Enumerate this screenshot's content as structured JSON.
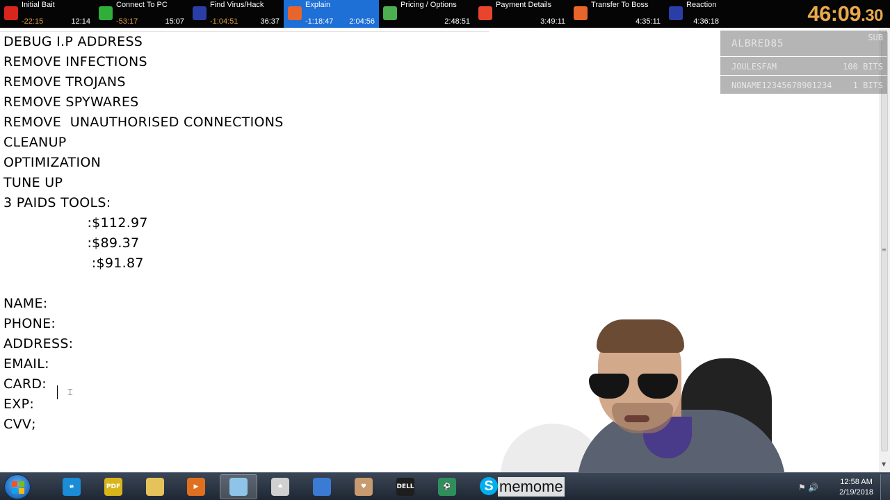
{
  "splits": [
    {
      "name": "Initial Bait",
      "delta": "-22:15",
      "time": "12:14",
      "icon": "flag-icon",
      "color": "#d8261c",
      "delta_color": "#e0a040"
    },
    {
      "name": "Connect To PC",
      "delta": "-53:17",
      "time": "15:07",
      "icon": "shield-icon",
      "color": "#2fae3a",
      "delta_color": "#e0a040"
    },
    {
      "name": "Find Virus/Hack",
      "delta": "-1:04:51",
      "time": "36:37",
      "icon": "virus-icon",
      "color": "#2a3ea8",
      "delta_color": "#e0a040"
    },
    {
      "name": "Explain",
      "delta": "-1:18:47",
      "time": "2:04:56",
      "icon": "envelope-icon",
      "color": "#e8652c",
      "delta_color": "#ffffff"
    },
    {
      "name": "Pricing / Options",
      "delta": "",
      "time": "2:48:51",
      "icon": "money-icon",
      "color": "#4caf50",
      "delta_color": "#e0a040"
    },
    {
      "name": "Payment Details",
      "delta": "",
      "time": "3:49:11",
      "icon": "fire-icon",
      "color": "#e8452c",
      "delta_color": "#e0a040"
    },
    {
      "name": "Transfer To Boss",
      "delta": "",
      "time": "4:35:11",
      "icon": "envelope-icon",
      "color": "#e8652c",
      "delta_color": "#e0a040"
    },
    {
      "name": "Reaction",
      "delta": "",
      "time": "4:36:18",
      "icon": "face-icon",
      "color": "#2a3ea8",
      "delta_color": "#e0a040"
    }
  ],
  "timer": {
    "main": "46:09",
    "fraction": ".30",
    "color": "#e8a94c"
  },
  "document": {
    "lines": [
      "DEBUG I.P ADDRESS",
      "REMOVE INFECTIONS",
      "REMOVE TROJANS",
      "REMOVE SPYWARES",
      "REMOVE  UNAUTHORISED CONNECTIONS",
      "CLEANUP",
      "OPTIMIZATION",
      "TUNE UP",
      "3 PAIDS TOOLS:",
      "                   :$112.97",
      "                   :$89.37",
      "                    :$91.87",
      "",
      "NAME:",
      "PHONE:",
      "ADDRESS:",
      "EMAIL:",
      "CARD:",
      "EXP:",
      "CVV;"
    ]
  },
  "alerts": {
    "top": {
      "name": "ALBRED85",
      "value": "SUB"
    },
    "rows": [
      {
        "name": "JOULESFAM",
        "value": "100 BITS"
      },
      {
        "name": "NONAME12345678901234",
        "value": "1 BITS"
      }
    ]
  },
  "taskbar": {
    "apps": [
      {
        "name": "internet-explorer-icon",
        "label": "e",
        "color": "#1a8cd8"
      },
      {
        "name": "pdf-icon",
        "label": "PDF",
        "color": "#d9b51c"
      },
      {
        "name": "folder-icon",
        "label": "",
        "color": "#e6c35a"
      },
      {
        "name": "media-player-icon",
        "label": "▶",
        "color": "#e07020"
      },
      {
        "name": "notepad-icon",
        "label": "",
        "color": "#8fc4e8"
      },
      {
        "name": "solitaire-icon",
        "label": "♠",
        "color": "#d0d0d0"
      },
      {
        "name": "word-doc-icon",
        "label": "",
        "color": "#3b7bd4"
      },
      {
        "name": "cards-game-icon",
        "label": "♥",
        "color": "#c89a70"
      },
      {
        "name": "dell-icon",
        "label": "DELL",
        "color": "#1e1e1e"
      },
      {
        "name": "soccer-icon",
        "label": "⚽",
        "color": "#2f8f5a"
      }
    ],
    "watermark": "memome",
    "clock_time": "12:58 AM",
    "clock_date": "2/19/2018"
  }
}
